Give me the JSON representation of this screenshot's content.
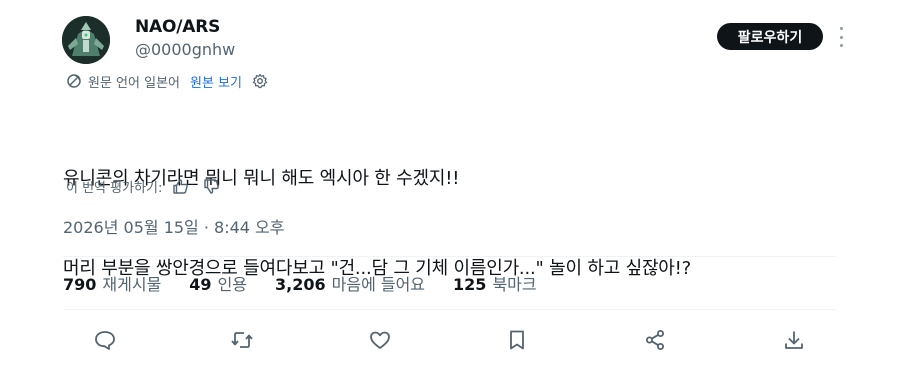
{
  "author": {
    "display_name": "NAO/ARS",
    "handle": "@0000gnhw",
    "avatar_icon": "robot-mecha-avatar"
  },
  "follow_label": "팔로우하기",
  "translation": {
    "note": "원문 언어 일본어",
    "show_original": "원본 보기"
  },
  "post": {
    "lines": [
      "유니콘의 차기라면 뭐니 뭐니 해도 엑시아 한 수겠지!!",
      "머리 부분을 쌍안경으로 들여다보고 \"건...담 그 기체 이름인가...\" 놀이 하고 싶잖아!?"
    ]
  },
  "rate_translation_label": "이 번역 평가하기:",
  "timestamp": "2026년 05월 15일 · 8:44 오후",
  "stats": [
    {
      "count": "790",
      "label": "재게시물"
    },
    {
      "count": "49",
      "label": "인용"
    },
    {
      "count": "3,206",
      "label": "마음에 들어요"
    },
    {
      "count": "125",
      "label": "북마크"
    }
  ],
  "actions": [
    "reply-icon",
    "repost-icon",
    "like-icon",
    "bookmark-icon",
    "share-icon",
    "download-icon"
  ],
  "colors": {
    "text": "#0f1419",
    "secondary": "#536471",
    "link": "#1d6fe0",
    "follow_bg": "#0f1419"
  }
}
